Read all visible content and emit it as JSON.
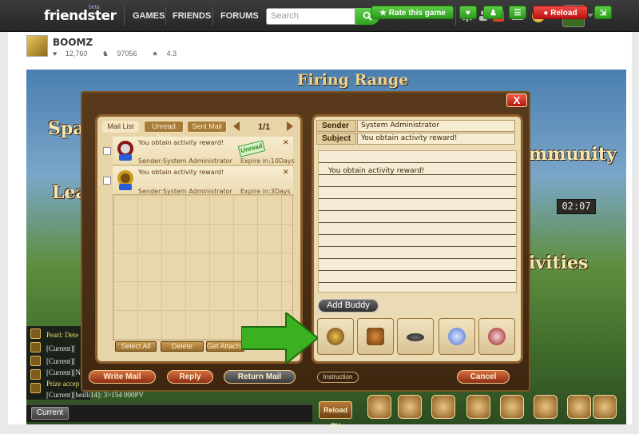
{
  "topnav": {
    "logo": "friendster",
    "logo_sup": "beta",
    "items": [
      "GAMES",
      "FRIENDS",
      "FORUMS"
    ],
    "search_placeholder": "Search",
    "notif_count": "1",
    "coins": "0"
  },
  "game_header": {
    "title": "BOOMZ",
    "likes": "12,760",
    "plays": "97056",
    "rating": "4.3",
    "rate_label": "Rate this game",
    "reload_label": "Reload"
  },
  "game_scene": {
    "heading": "Firing Range",
    "bg_words": [
      "Spa",
      "Lea",
      "mmunity",
      "ivities"
    ],
    "timer": "02:07",
    "chat_lines": [
      "Pearl: Dete",
      "[Current][",
      "[Current][",
      "[Current][N",
      "Prize accep",
      "[Current][heilli14]: 3>154 000PV"
    ],
    "chat_tab": "Current",
    "reload_pv": "Reload PV"
  },
  "mail_dialog": {
    "close": "X",
    "tabs": [
      "Mail List",
      "Unread Mail",
      "Sent Mail"
    ],
    "pager": "1/1",
    "items": [
      {
        "subject": "You obtain activity reward!",
        "sender": "Sender:System Administrator",
        "expire": "Expire in:10Days",
        "badge": "Unread"
      },
      {
        "subject": "You obtain activity reward!",
        "sender": "Sender:System Administrator",
        "expire": "Expire in:3Days"
      }
    ],
    "list_buttons": [
      "Select All",
      "Delete",
      "Get Attachment"
    ],
    "detail": {
      "sender_label": "Sender",
      "sender_value": "System Administrator",
      "subject_label": "Subject",
      "subject_value": "You obtain activity reward!",
      "body": "You obtain activity reward!",
      "add_buddy": "Add Buddy"
    },
    "bottom_buttons": {
      "write": "Write Mail",
      "reply": "Reply",
      "return": "Return Mail",
      "instruction": "Instruction",
      "cancel": "Cancel"
    },
    "colors": {
      "accent_green": "#3bb020",
      "frame": "#8b5e2a"
    }
  }
}
